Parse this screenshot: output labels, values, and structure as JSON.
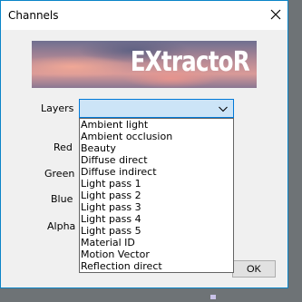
{
  "window": {
    "title": "Channels"
  },
  "banner": {
    "logo_text": "EXtractoR"
  },
  "labels": {
    "layers": "Layers",
    "red": "Red",
    "green": "Green",
    "blue": "Blue",
    "alpha": "Alpha"
  },
  "layers_combo": {
    "selected_value": ""
  },
  "dropdown": {
    "items": [
      "Ambient light",
      "Ambient occlusion",
      "Beauty",
      "Diffuse direct",
      "Diffuse indirect",
      "Light pass 1",
      "Light pass 2",
      "Light pass 3",
      "Light pass 4",
      "Light pass 5",
      "Material ID",
      "Motion Vector",
      "Reflection direct"
    ]
  },
  "buttons": {
    "ok_label": "OK"
  },
  "icons": {
    "close": "close-icon",
    "chevron": "chevron-down-icon"
  },
  "colors": {
    "accent": "#0078d7",
    "combo_bg": "#cce4f7"
  }
}
